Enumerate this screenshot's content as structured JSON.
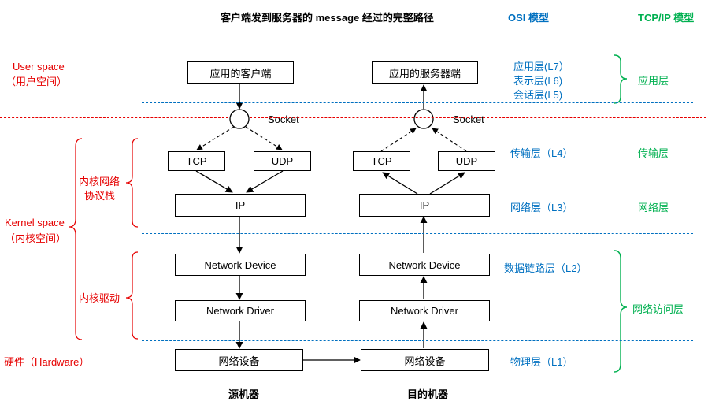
{
  "title": "客户端发到服务器的 message 经过的完整路径",
  "osi_header": "OSI 模型",
  "tcpip_header": "TCP/IP 模型",
  "source_footer": "源机器",
  "dest_footer": "目的机器",
  "red": {
    "user_space_en": "User space",
    "user_space_cn": "（用户空间）",
    "kernel_stack_l1": "内核网络",
    "kernel_stack_l2": "协议栈",
    "kernel_space_en": "Kernel space",
    "kernel_space_cn": "（内核空间）",
    "kernel_driver": "内核驱动",
    "hardware": "硬件（Hardware）"
  },
  "boxes": {
    "src_app": "应用的客户端",
    "dst_app": "应用的服务器端",
    "tcp": "TCP",
    "udp": "UDP",
    "ip": "IP",
    "net_device": "Network Device",
    "net_driver": "Network Driver",
    "net_hw": "网络设备"
  },
  "socket": "Socket",
  "osi": {
    "l7": "应用层(L7）",
    "l6": "表示层(L6)",
    "l5": "会话层(L5)",
    "l4": "传输层（L4）",
    "l3": "网络层（L3）",
    "l2": "数据链路层（L2）",
    "l1": "物理层（L1）"
  },
  "tcpip": {
    "app": "应用层",
    "transport": "传输层",
    "network": "网络层",
    "netaccess": "网络访问层"
  }
}
